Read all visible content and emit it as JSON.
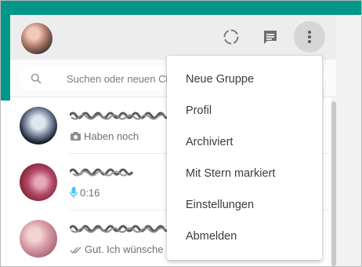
{
  "header": {
    "avatar_icon": "profile-avatar",
    "status_icon": "status-ring-icon",
    "new_chat_icon": "new-chat-icon",
    "menu_icon": "more-vertical-icon"
  },
  "search": {
    "placeholder": "Suchen oder neuen Chat beginnen",
    "icon": "search-icon"
  },
  "chats": [
    {
      "name_redacted": true,
      "preview_icon": "camera-icon",
      "preview_text": "Haben noch"
    },
    {
      "name_redacted": true,
      "preview_icon": "microphone-icon",
      "preview_text": "0:16"
    },
    {
      "name_redacted": true,
      "preview_icon": "double-check-icon",
      "preview_text": "Gut. Ich wünsche"
    }
  ],
  "menu": {
    "items": [
      {
        "label": "Neue Gruppe"
      },
      {
        "label": "Profil"
      },
      {
        "label": "Archiviert"
      },
      {
        "label": "Mit Stern markiert"
      },
      {
        "label": "Einstellungen"
      },
      {
        "label": "Abmelden"
      }
    ]
  },
  "colors": {
    "teal": "#009688",
    "header_bg": "#ededed",
    "mic_blue": "#4fc3f7"
  }
}
